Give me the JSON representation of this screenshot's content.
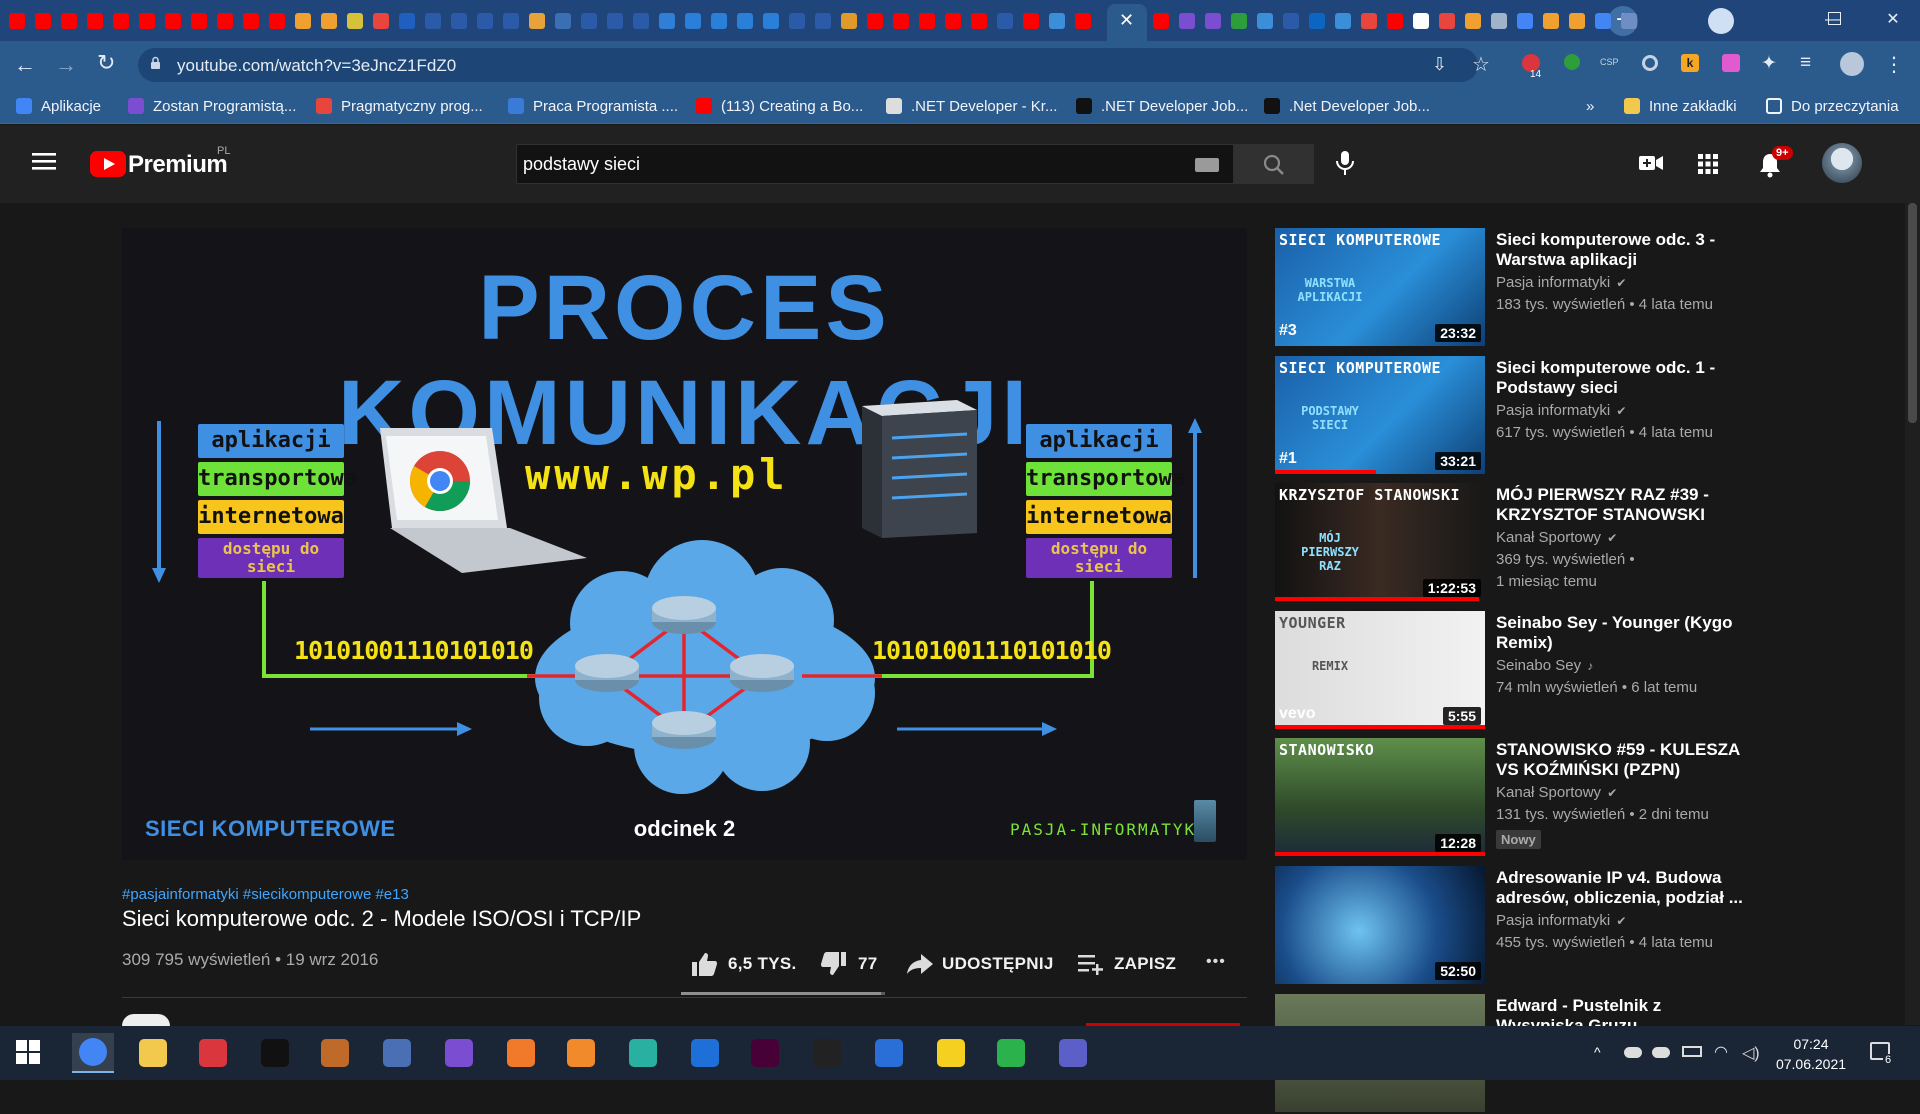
{
  "browser": {
    "url": "youtube.com/watch?v=3eJncZ1FdZ0",
    "tab_count_badge": "14",
    "bookmarks": [
      {
        "label": "Aplikacje",
        "color": "#4285f4"
      },
      {
        "label": "Zostan Programistą...",
        "color": "#7b4dd0"
      },
      {
        "label": "Pragmatyczny prog...",
        "color": "#e8453c"
      },
      {
        "label": "Praca Programista ....",
        "color": "#3b7bd8"
      },
      {
        "label": "(113) Creating a Bo...",
        "color": "#ff0000"
      },
      {
        "label": ".NET Developer - Kr...",
        "color": "#dddddd"
      },
      {
        "label": ".NET Developer Job...",
        "color": "#111111"
      },
      {
        "label": ".Net Developer Job...",
        "color": "#111111"
      }
    ],
    "bookmarks_overflow": "»",
    "other_bookmarks": "Inne zakładki",
    "reading_list": "Do przeczytania"
  },
  "youtube": {
    "logo_text": "Premium",
    "region": "PL",
    "search_query": "podstawy sieci",
    "notifications": "9+",
    "video": {
      "thumbnail_title": "PROCES KOMUNIKACJI",
      "layers_left": [
        "aplikacji",
        "transportowa",
        "internetowa",
        "dostępu do sieci"
      ],
      "layers_right": [
        "aplikacji",
        "transportowa",
        "internetowa",
        "dostępu do sieci"
      ],
      "url_text": "www.wp.pl",
      "bits_left": "10101001110101010",
      "bits_right": "10101001110101010",
      "series_label": "SIECI KOMPUTEROWE",
      "episode_label": "odcinek 2",
      "brand_label": "PASJA-INFORMATYKI",
      "hashtags": "#pasjainformatyki #siecikomputerowe #e13",
      "title": "Sieci komputerowe odc. 2 - Modele ISO/OSI i TCP/IP",
      "views_date": "309 795 wyświetleń • 19 wrz 2016",
      "likes": "6,5 TYS.",
      "dislikes": "77",
      "share_label": "UDOSTĘPNIJ",
      "save_label": "ZAPISZ",
      "more_label": "•••",
      "like_ratio": 0.98
    },
    "recommendations": [
      {
        "title_line1": "Sieci komputerowe odc. 3 -",
        "title_line2": "Warstwa aplikacji",
        "channel": "Pasja informatyki",
        "badge": "✔",
        "meta": "183 tys. wyświetleń • 4 lata temu",
        "meta2": "",
        "duration": "23:32",
        "thumb_top": "SIECI KOMPUTEROWE",
        "thumb_sub": "WARSTWA APLIKACJI",
        "thumb_num": "#3",
        "new_label": "",
        "progress": 0
      },
      {
        "title_line1": "Sieci komputerowe odc. 1 -",
        "title_line2": "Podstawy sieci",
        "channel": "Pasja informatyki",
        "badge": "✔",
        "meta": "617 tys. wyświetleń • 4 lata temu",
        "meta2": "",
        "duration": "33:21",
        "thumb_top": "SIECI KOMPUTEROWE",
        "thumb_sub": "PODSTAWY SIECI",
        "thumb_num": "#1",
        "new_label": "",
        "progress": 0.48
      },
      {
        "title_line1": "MÓJ PIERWSZY RAZ #39 -",
        "title_line2": "KRZYSZTOF STANOWSKI",
        "channel": "Kanał Sportowy",
        "badge": "✔",
        "meta": "369 tys. wyświetleń •",
        "meta2": "1 miesiąc temu",
        "duration": "1:22:53",
        "thumb_top": "KRZYSZTOF STANOWSKI",
        "thumb_sub": "MÓJ PIERWSZY RAZ",
        "thumb_num": "",
        "new_label": "",
        "progress": 0.97
      },
      {
        "title_line1": "Seinabo Sey - Younger (Kygo",
        "title_line2": "Remix)",
        "channel": "Seinabo Sey",
        "badge": "♪",
        "meta": "74 mln wyświetleń • 6 lat temu",
        "meta2": "",
        "duration": "5:55",
        "thumb_top": "YOUNGER",
        "thumb_sub": "REMIX",
        "thumb_num": "vevo",
        "new_label": "",
        "progress": 1.0
      },
      {
        "title_line1": "STANOWISKO #59 - KULESZA",
        "title_line2": "VS KOŹMIŃSKI (PZPN)",
        "channel": "Kanał Sportowy",
        "badge": "✔",
        "meta": "131 tys. wyświetleń • 2 dni temu",
        "meta2": "",
        "duration": "12:28",
        "thumb_top": "STANOWISKO",
        "thumb_sub": "",
        "thumb_num": "",
        "new_label": "Nowy",
        "progress": 1.0
      },
      {
        "title_line1": "Adresowanie IP v4. Budowa",
        "title_line2": "adresów, obliczenia, podział ...",
        "channel": "Pasja informatyki",
        "badge": "✔",
        "meta": "455 tys. wyświetleń • 4 lata temu",
        "meta2": "",
        "duration": "52:50",
        "thumb_top": "",
        "thumb_sub": "",
        "thumb_num": "",
        "new_label": "",
        "progress": 0
      },
      {
        "title_line1": "Edward - Pustelnik z",
        "title_line2": "Wysypiska Gruzu...",
        "channel": "",
        "badge": "",
        "meta": "",
        "meta2": "",
        "duration": "",
        "thumb_top": "",
        "thumb_sub": "",
        "thumb_num": "",
        "new_label": "",
        "progress": 0
      }
    ]
  },
  "taskbar": {
    "time": "07:24",
    "date": "07.06.2021",
    "notification_count": "6"
  }
}
